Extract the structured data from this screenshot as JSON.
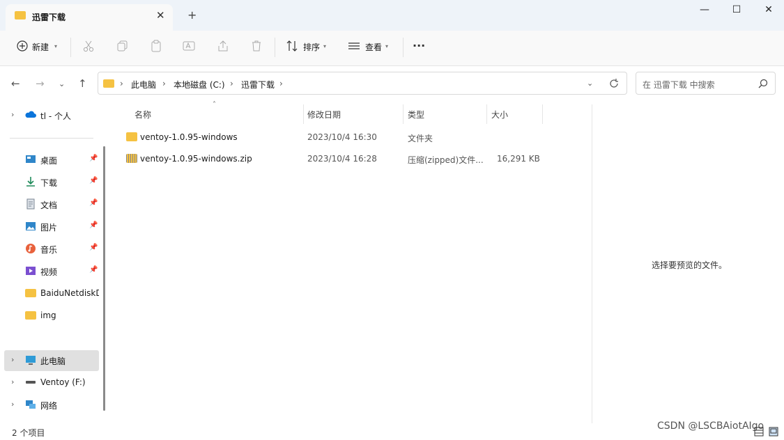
{
  "window": {
    "tab_title": "迅雷下载",
    "tab_close": "✕",
    "new_tab": "+",
    "minimize": "—",
    "maximize": "☐",
    "close": "✕"
  },
  "toolbar": {
    "new_label": "新建",
    "sort_label": "排序",
    "view_label": "查看",
    "more_label": "···"
  },
  "address": {
    "crumbs": [
      "此电脑",
      "本地磁盘 (C:)",
      "迅雷下载"
    ],
    "search_placeholder": "在 迅雷下载 中搜索"
  },
  "sidebar": {
    "onedrive": "tl - 个人",
    "quick": [
      {
        "label": "桌面",
        "icon": "desktop-icon"
      },
      {
        "label": "下载",
        "icon": "download-icon"
      },
      {
        "label": "文档",
        "icon": "document-icon"
      },
      {
        "label": "图片",
        "icon": "pictures-icon"
      },
      {
        "label": "音乐",
        "icon": "music-icon"
      },
      {
        "label": "视频",
        "icon": "video-icon"
      }
    ],
    "folders": [
      "BaiduNetdiskD",
      "img"
    ],
    "this_pc": "此电脑",
    "ventoy": "Ventoy (F:)",
    "network": "网络"
  },
  "columns": {
    "name": "名称",
    "date": "修改日期",
    "type": "类型",
    "size": "大小"
  },
  "files": [
    {
      "name": "ventoy-1.0.95-windows",
      "date": "2023/10/4 16:30",
      "type": "文件夹",
      "size": "",
      "icon": "folder-icon"
    },
    {
      "name": "ventoy-1.0.95-windows.zip",
      "date": "2023/10/4 16:28",
      "type": "压缩(zipped)文件...",
      "size": "16,291 KB",
      "icon": "zip-folder-icon"
    }
  ],
  "preview_text": "选择要预览的文件。",
  "status": "2 个项目",
  "watermark": "CSDN @LSCBAiotAIgo",
  "colors": {
    "accent": "#0067c0",
    "folder": "#f5c242",
    "selected": "#e0e0e0"
  }
}
